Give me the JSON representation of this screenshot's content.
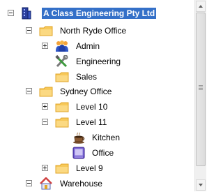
{
  "tree": {
    "root": {
      "label": "A Class Engineering Pty Ltd",
      "expanded": true,
      "selected": true,
      "icon": "building-icon"
    },
    "north_ryde": {
      "label": "North Ryde Office",
      "expanded": true,
      "icon": "folder-icon",
      "admin": {
        "label": "Admin",
        "expanded": false,
        "icon": "people-icon"
      },
      "engineering": {
        "label": "Engineering",
        "icon": "tools-icon"
      },
      "sales": {
        "label": "Sales",
        "icon": "folder-icon"
      }
    },
    "sydney": {
      "label": "Sydney Office",
      "expanded": true,
      "icon": "folder-icon",
      "level10": {
        "label": "Level 10",
        "expanded": false,
        "icon": "folder-icon"
      },
      "level11": {
        "label": "Level 11",
        "expanded": true,
        "icon": "folder-icon",
        "kitchen": {
          "label": "Kitchen",
          "icon": "coffee-cup-icon"
        },
        "office": {
          "label": "Office",
          "icon": "office-icon"
        }
      },
      "level9": {
        "label": "Level 9",
        "expanded": false,
        "icon": "folder-icon"
      }
    },
    "warehouse": {
      "label": "Warehouse",
      "expanded": true,
      "icon": "house-icon"
    }
  },
  "colors": {
    "selection": "#3470c8",
    "folder": "#f7c95a",
    "folder_outline": "#e0a528"
  }
}
